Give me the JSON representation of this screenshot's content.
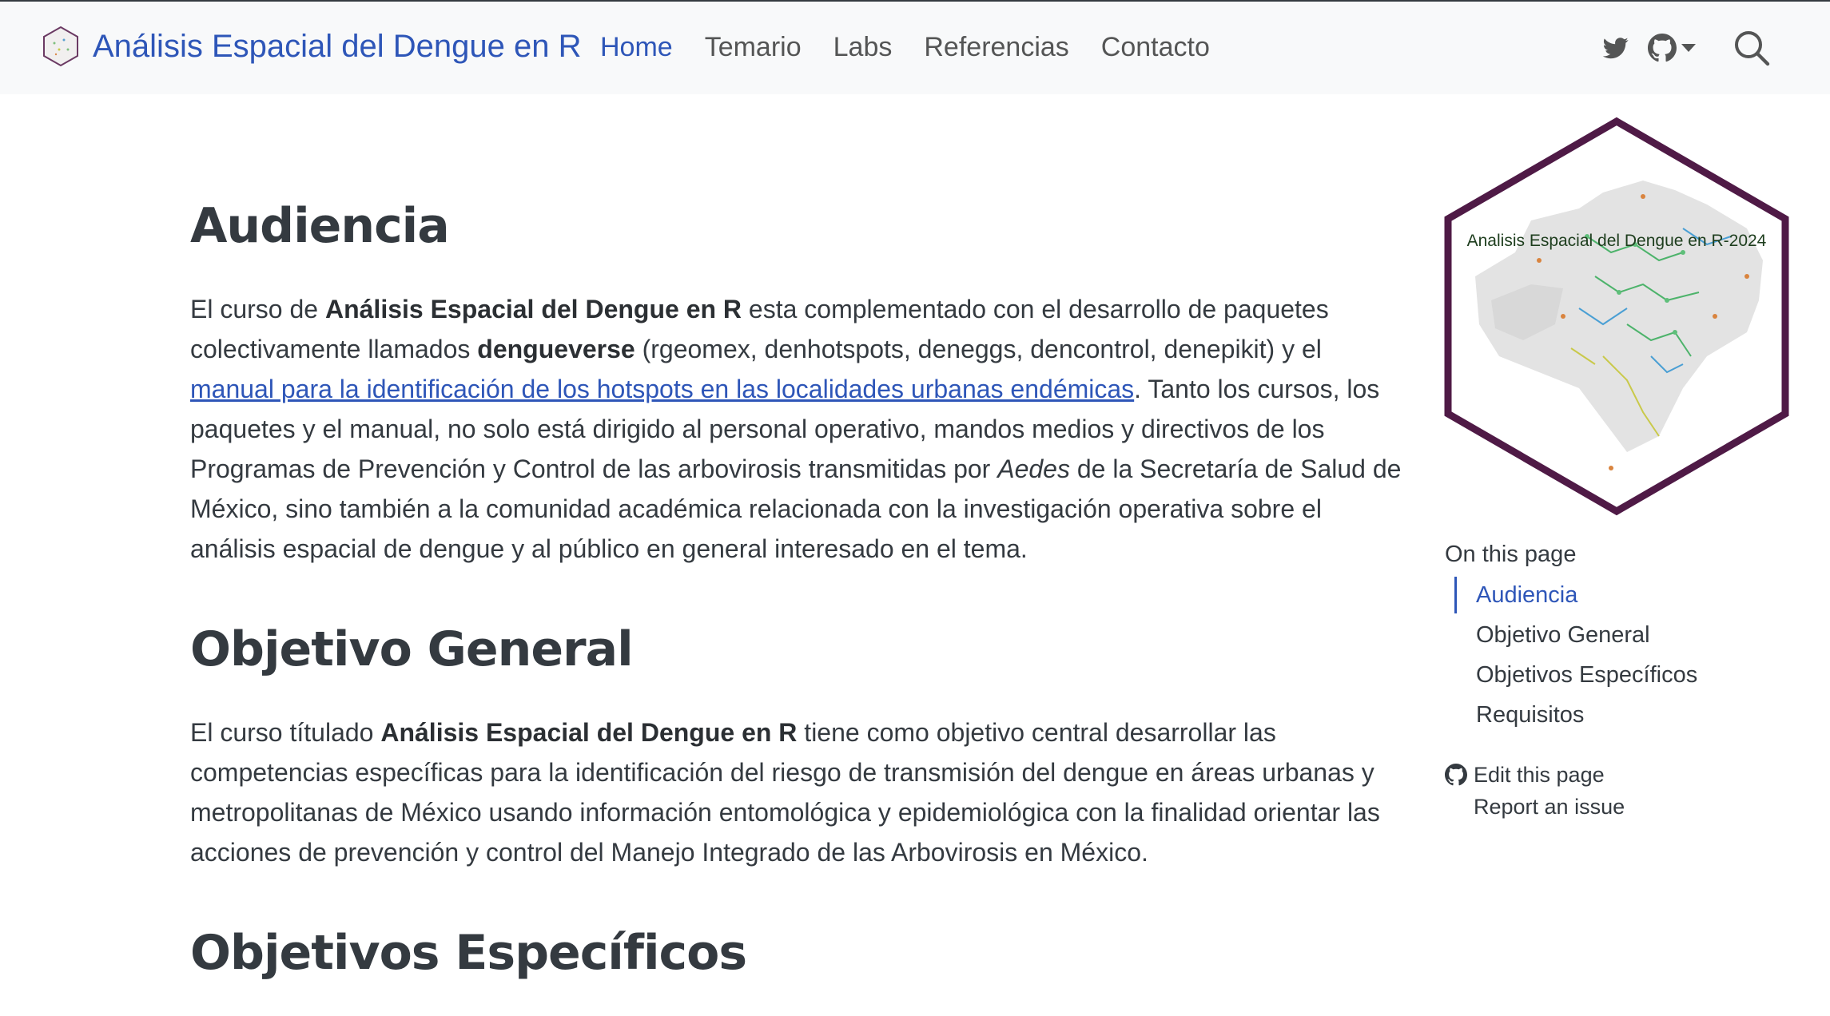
{
  "navbar": {
    "brand": "Análisis Espacial del Dengue en R",
    "links": [
      "Home",
      "Temario",
      "Labs",
      "Referencias",
      "Contacto"
    ],
    "active_link": "Home",
    "icons": [
      "twitter-icon",
      "github-icon",
      "chevron-down-icon",
      "search-icon"
    ]
  },
  "sections": {
    "audiencia": {
      "title": "Audiencia",
      "p1": "El curso de ",
      "b1": "Análisis Espacial del Dengue en R",
      "p2": " esta complementado con el desarrollo de paquetes colectivamente llamados ",
      "b2": "dengueverse",
      "p3": " (rgeomex, denhotspots, deneggs, dencontrol, denepikit) y el ",
      "link": "manual para la identificación de los hotspots en las localidades urbanas endémicas",
      "p4": ". Tanto los cursos, los paquetes y el manual, no solo está dirigido al personal operativo, mandos medios y directivos de los Programas de Prevención y Control de las arbovirosis transmitidas por ",
      "i1": "Aedes",
      "p5": " de la Secretaría de Salud de México, sino también a la comunidad académica relacionada con la investigación operativa sobre el análisis espacial de dengue y al público en general interesado en el tema."
    },
    "objetivo_general": {
      "title": "Objetivo General",
      "p1": "El curso títulado ",
      "b1": "Análisis Espacial del Dengue en R",
      "p2": " tiene como objetivo central desarrollar las competencias específicas para la identificación del riesgo de transmisión del dengue en áreas urbanas y metropolitanas de México usando información entomológica y epidemiológica con la finalidad orientar las acciones de prevención y control del Manejo Integrado de las Arbovirosis en México."
    },
    "objetivos_especificos": {
      "title": "Objetivos Específicos"
    }
  },
  "sidebar": {
    "logo_title": "Analisis Espacial del Dengue en R-2024",
    "toc_title": "On this page",
    "toc": [
      "Audiencia",
      "Objetivo General",
      "Objetivos Específicos",
      "Requisitos"
    ],
    "toc_active": "Audiencia",
    "edit_label": "Edit this page",
    "issue_label": "Report an issue"
  },
  "colors": {
    "accent": "#2e56b8",
    "text": "#343a40",
    "navbar_bg": "#f8f9fa",
    "hex_border": "#4f1a46"
  }
}
